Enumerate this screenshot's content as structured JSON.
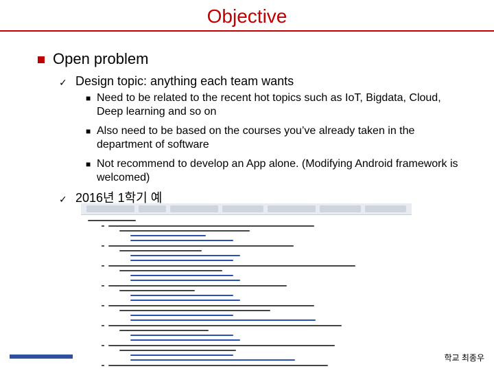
{
  "slide": {
    "title": "Objective",
    "level1": "Open problem",
    "items": [
      {
        "text": "Design topic: anything each team wants",
        "subitems": [
          "Need to be related to the recent hot topics such as IoT, Bigdata, Cloud, Deep learning and so on",
          "Also need to be based on the courses you’ve already taken in the department of software",
          "Not recommend to develop an App alone. (Modifying Android framework is welcomed)"
        ]
      },
      {
        "text": "2016년 1학기 예"
      }
    ],
    "footer": "학교 최종우"
  },
  "colors": {
    "accent": "#c00000",
    "footer_bar": "#2f4f9f",
    "link_blue": "#2a4fb5",
    "doc_text": "#444444"
  },
  "icons": {
    "level1_bullet": "red-square-icon",
    "level2_bullet": "checkmark-icon",
    "level3_bullet": "square-bullet-icon"
  }
}
